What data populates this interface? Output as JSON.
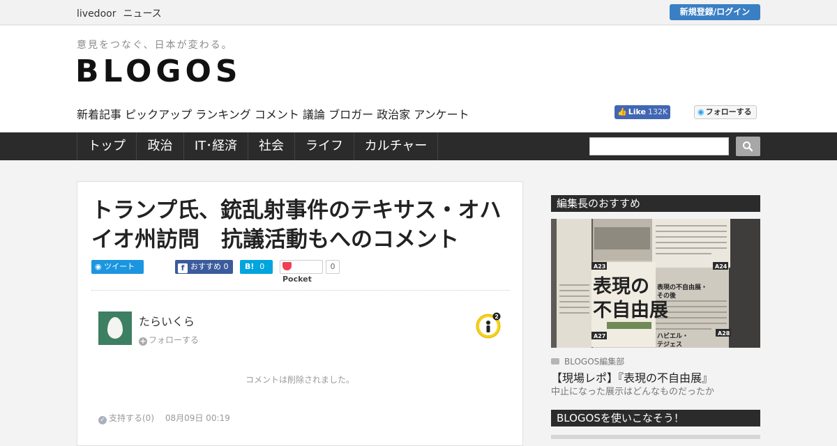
{
  "topbar": {
    "brand": "livedoor",
    "brand_sub": "ニュース",
    "login_label": "新規登録/ログイン"
  },
  "header": {
    "tagline": "意見をつなぐ、日本が変わる。",
    "logo": "BLOGOS",
    "categories": [
      "新着記事",
      "ピックアップ",
      "ランキング",
      "コメント",
      "議論",
      "ブロガー",
      "政治家",
      "アンケート"
    ],
    "fb_like_label": "Like",
    "fb_like_count": "132K",
    "tw_follow_label": "フォローする"
  },
  "mainnav": {
    "items": [
      "トップ",
      "政治",
      "IT･経済",
      "社会",
      "ライフ",
      "カルチャー"
    ],
    "search_value": ""
  },
  "article": {
    "title_line1": "トランプ氏、銃乱射事件のテキサス・オハ",
    "title_line2": "イオ州訪問　抗議活動もへのコメント",
    "share": {
      "tweet_label": "ツイート",
      "fb_label": "おすすめ",
      "fb_count": "0",
      "hatena_label": "B!",
      "hatena_count": "0",
      "pocket_label": "Pocket",
      "pocket_count": "0"
    },
    "author": {
      "name": "たらいくら",
      "follow_label": "フォローする",
      "badge_count": "2"
    },
    "comment_text": "コメントは削除されました。",
    "support_label": "支持する(0)",
    "date": "08月09日 00:19"
  },
  "sidebar": {
    "editor_pick_heading": "編集長のおすすめ",
    "feature": {
      "source": "BLOGOS編集部",
      "title": "【現場レポ】『表現の不自由展』",
      "subtitle": "中止になった展示はどんなものだったか",
      "image_headline1": "表現の",
      "image_headline2": "不自由展",
      "image_tag_a23": "A23",
      "image_tag_a24": "A24",
      "image_tag_a27": "A27",
      "image_tag_a28": "A28",
      "image_caption1": "表現の不自由展・",
      "image_caption2": "その後",
      "image_caption3": "ハビエル・",
      "image_caption4": "テジェス"
    },
    "howto_heading": "BLOGOSを使いこなそう！"
  },
  "colors": {
    "accent_blue": "#3a7fc4",
    "nav_dark": "#2b2b2b",
    "twitter": "#1b95e0",
    "facebook": "#3b5b9c",
    "hatena": "#00a4de",
    "pocket": "#ef4056"
  }
}
